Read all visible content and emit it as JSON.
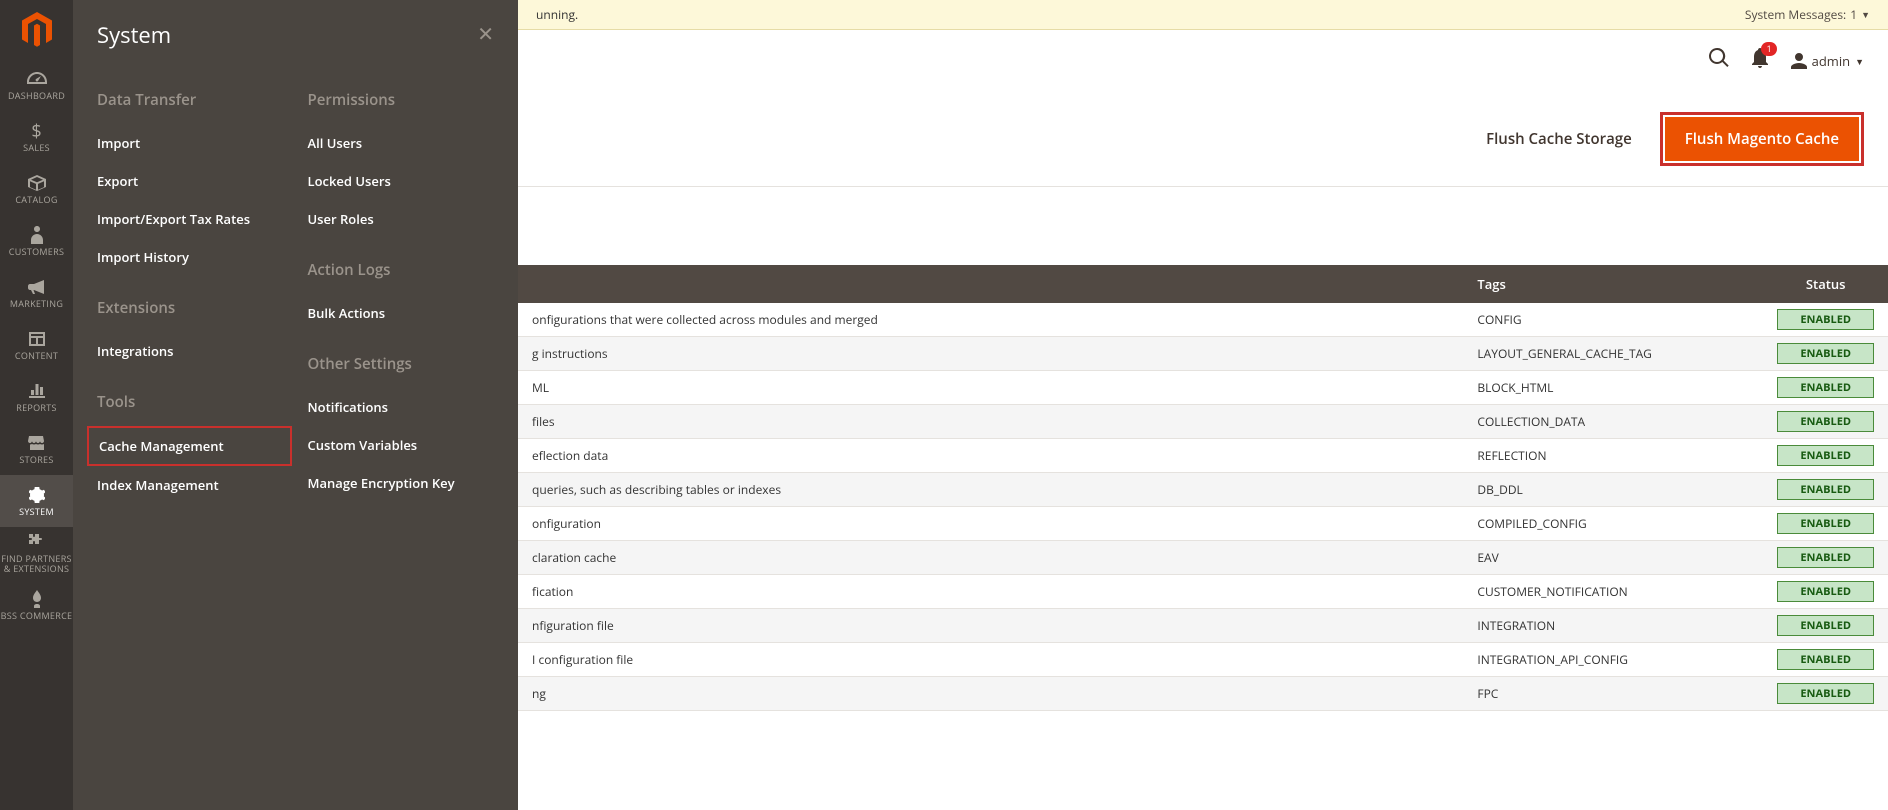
{
  "sidebar": {
    "items": [
      {
        "label": "DASHBOARD"
      },
      {
        "label": "SALES"
      },
      {
        "label": "CATALOG"
      },
      {
        "label": "CUSTOMERS"
      },
      {
        "label": "MARKETING"
      },
      {
        "label": "CONTENT"
      },
      {
        "label": "REPORTS"
      },
      {
        "label": "STORES"
      },
      {
        "label": "SYSTEM"
      },
      {
        "label": "FIND PARTNERS & EXTENSIONS"
      },
      {
        "label": "BSS COMMERCE"
      }
    ]
  },
  "flyout": {
    "title": "System",
    "columns": [
      {
        "groups": [
          {
            "heading": "Data Transfer",
            "links": [
              "Import",
              "Export",
              "Import/Export Tax Rates",
              "Import History"
            ]
          },
          {
            "heading": "Extensions",
            "links": [
              "Integrations"
            ]
          },
          {
            "heading": "Tools",
            "links": [
              "Cache Management",
              "Index Management"
            ]
          }
        ]
      },
      {
        "groups": [
          {
            "heading": "Permissions",
            "links": [
              "All Users",
              "Locked Users",
              "User Roles"
            ]
          },
          {
            "heading": "Action Logs",
            "links": [
              "Bulk Actions"
            ]
          },
          {
            "heading": "Other Settings",
            "links": [
              "Notifications",
              "Custom Variables",
              "Manage Encryption Key"
            ]
          }
        ]
      }
    ]
  },
  "banner": {
    "left_fragment": "unning.",
    "system_messages_label": "System Messages:",
    "system_messages_count": "1"
  },
  "topbar": {
    "notif_count": "1",
    "admin_label": "admin"
  },
  "actions": {
    "flush_storage": "Flush Cache Storage",
    "flush_magento": "Flush Magento Cache"
  },
  "table": {
    "headers": {
      "tags": "Tags",
      "status": "Status"
    },
    "rows": [
      {
        "desc": "onfigurations that were collected across modules and merged",
        "tag": "CONFIG",
        "status": "ENABLED"
      },
      {
        "desc": "g instructions",
        "tag": "LAYOUT_GENERAL_CACHE_TAG",
        "status": "ENABLED"
      },
      {
        "desc": "ML",
        "tag": "BLOCK_HTML",
        "status": "ENABLED"
      },
      {
        "desc": " files",
        "tag": "COLLECTION_DATA",
        "status": "ENABLED"
      },
      {
        "desc": "eflection data",
        "tag": "REFLECTION",
        "status": "ENABLED"
      },
      {
        "desc": " queries, such as describing tables or indexes",
        "tag": "DB_DDL",
        "status": "ENABLED"
      },
      {
        "desc": "onfiguration",
        "tag": "COMPILED_CONFIG",
        "status": "ENABLED"
      },
      {
        "desc": "claration cache",
        "tag": "EAV",
        "status": "ENABLED"
      },
      {
        "desc": "fication",
        "tag": "CUSTOMER_NOTIFICATION",
        "status": "ENABLED"
      },
      {
        "desc": "nfiguration file",
        "tag": "INTEGRATION",
        "status": "ENABLED"
      },
      {
        "desc": "I configuration file",
        "tag": "INTEGRATION_API_CONFIG",
        "status": "ENABLED"
      },
      {
        "desc": "ng",
        "tag": "FPC",
        "status": "ENABLED"
      }
    ]
  }
}
